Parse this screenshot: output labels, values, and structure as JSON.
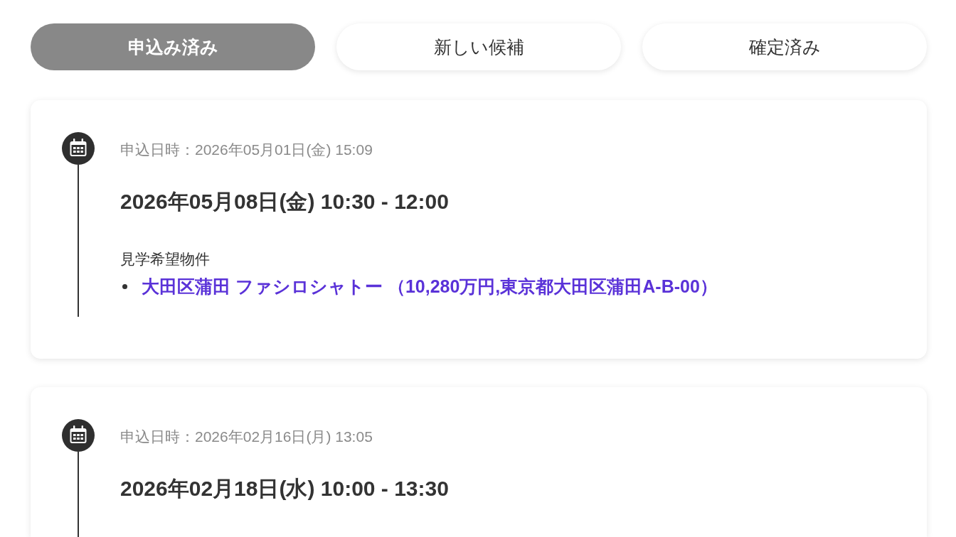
{
  "tabs": [
    {
      "label": "申込み済み",
      "selected": true
    },
    {
      "label": "新しい候補",
      "selected": false
    },
    {
      "label": "確定済み",
      "selected": false
    }
  ],
  "appointments": [
    {
      "applied_at": "申込日時：2026年05月01日(金) 15:09",
      "schedule": "2026年05月08日(金) 10:30 - 12:00",
      "properties_label": "見学希望物件",
      "properties": [
        "大田区蒲田 ファシロシャトー （10,280万円,東京都大田区蒲田A-B-00）"
      ]
    },
    {
      "applied_at": "申込日時：2026年02月16日(月) 13:05",
      "schedule": "2026年02月18日(水) 10:00 - 13:30"
    }
  ]
}
